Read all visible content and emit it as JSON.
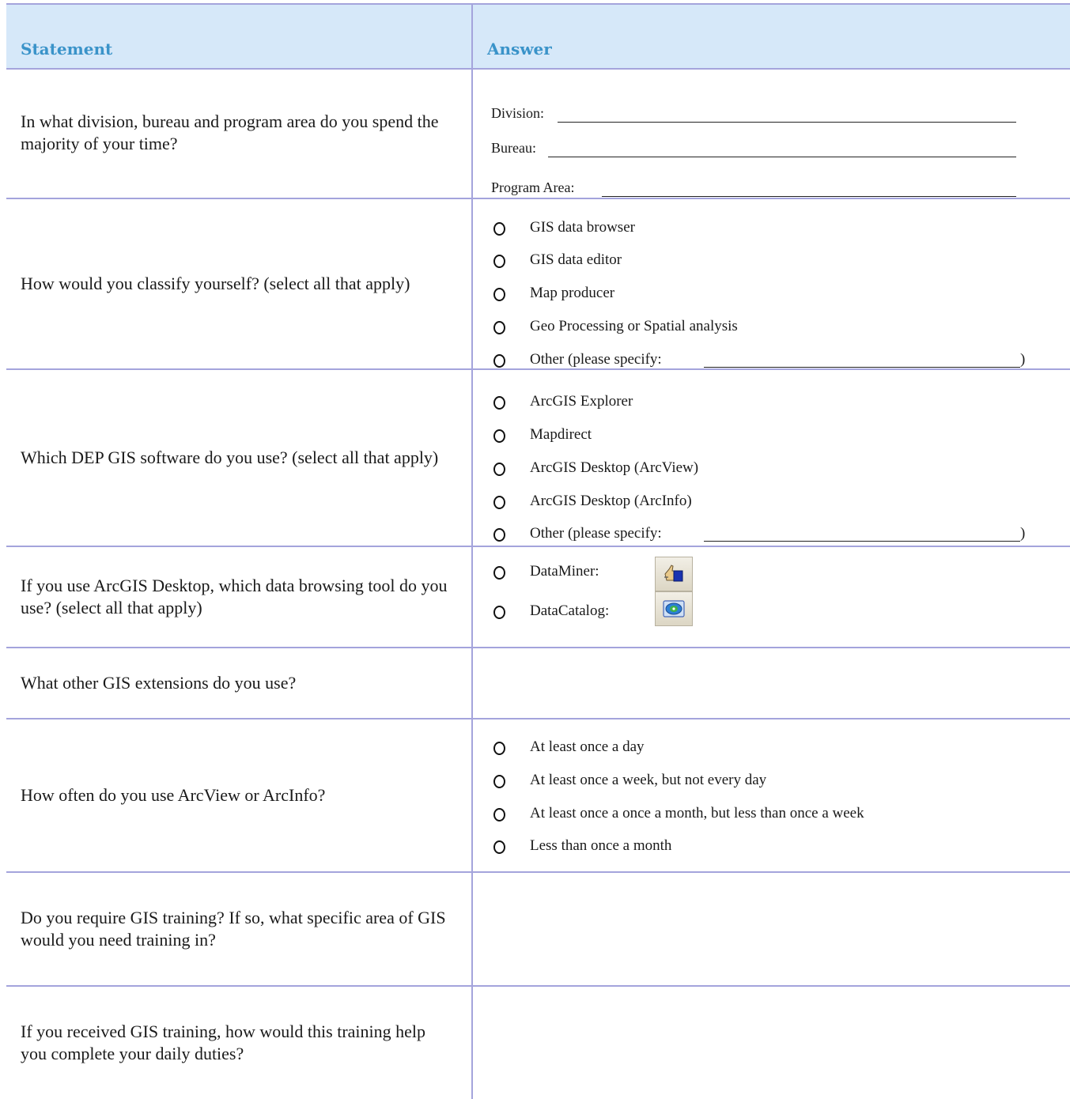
{
  "header": {
    "statement": "Statement",
    "answer": "Answer"
  },
  "rows": {
    "division": {
      "question": "In what division, bureau and program area do you spend the majority of your time?",
      "fields": [
        "Division:",
        "Bureau:",
        "Program Area:"
      ]
    },
    "classify": {
      "question": "How would you classify yourself? (select all that apply)",
      "options": [
        "GIS data browser",
        "GIS data editor",
        "Map producer",
        "Geo Processing or Spatial analysis",
        "Other (please specify:"
      ]
    },
    "software": {
      "question": "Which DEP GIS software do you use? (select all that apply)",
      "options": [
        "ArcGIS Explorer",
        "Mapdirect",
        "ArcGIS Desktop (ArcView)",
        "ArcGIS Desktop (ArcInfo)",
        "Other (please specify:"
      ]
    },
    "browsing_tool": {
      "question": "If  you use ArcGIS Desktop, which data browsing tool do you use? (select all that apply)",
      "options": [
        "DataMiner:",
        "DataCatalog:"
      ],
      "icons": [
        "dataminer-icon",
        "datacatalog-icon"
      ]
    },
    "extensions": {
      "question": "What other GIS extensions do you use?"
    },
    "frequency": {
      "question": "How often do you use ArcView or ArcInfo?",
      "options": [
        "At least once a day",
        "At least once a week, but not every day",
        "At least once a once a month, but less than once a week",
        "Less than once a month"
      ]
    },
    "training": {
      "question": "Do you require GIS training?  If so, what specific area of GIS would you need training in?"
    },
    "duties": {
      "question": "If you received GIS training, how would this training help you complete your daily duties?"
    }
  },
  "closing_paren": ")",
  "colors": {
    "header_bg": "#d6e8f9",
    "header_text": "#3a93c9",
    "rule": "#a4a4dc"
  }
}
